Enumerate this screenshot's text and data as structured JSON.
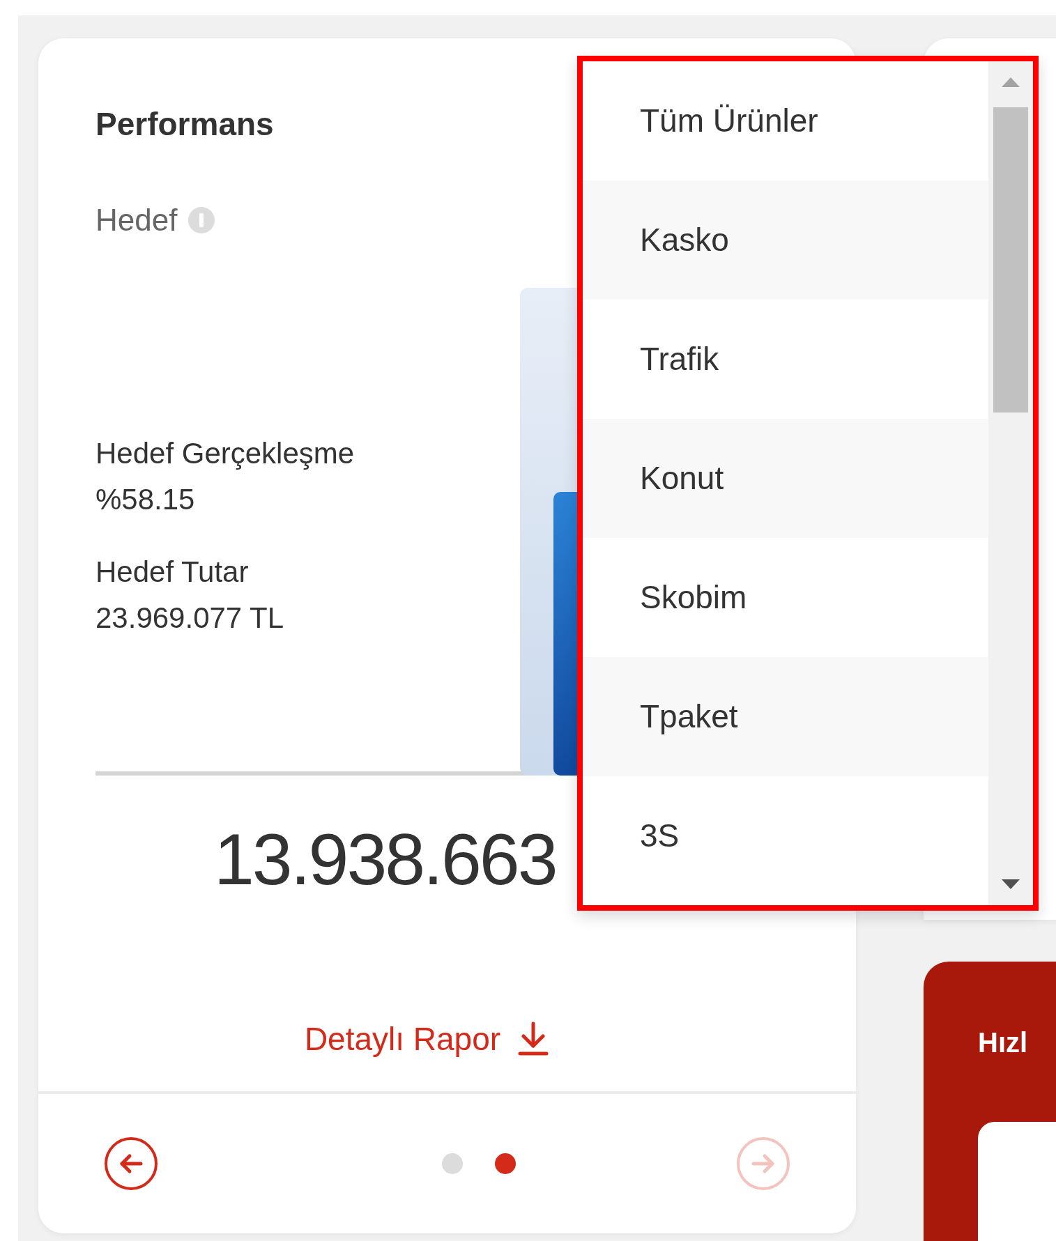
{
  "card": {
    "title": "Performans",
    "subtitle": "Hedef",
    "stats": [
      {
        "label": "Hedef Gerçekleşme",
        "value": "%58.15"
      },
      {
        "label": "Hedef Tutar",
        "value": "23.969.077 TL"
      }
    ],
    "total": "13.938.663",
    "report_link": "Detaylı Rapor",
    "pager": {
      "prev": {
        "disabled": false
      },
      "next": {
        "disabled": true
      },
      "dots": [
        {
          "selected": false
        },
        {
          "selected": true
        }
      ]
    }
  },
  "dropdown": {
    "options": [
      {
        "label": "Tüm Ürünler"
      },
      {
        "label": "Kasko"
      },
      {
        "label": "Trafik"
      },
      {
        "label": "Konut"
      },
      {
        "label": "Skobim"
      },
      {
        "label": "Tpaket"
      },
      {
        "label": "3S"
      }
    ]
  },
  "side_panel": {
    "title": "Hızl"
  }
}
